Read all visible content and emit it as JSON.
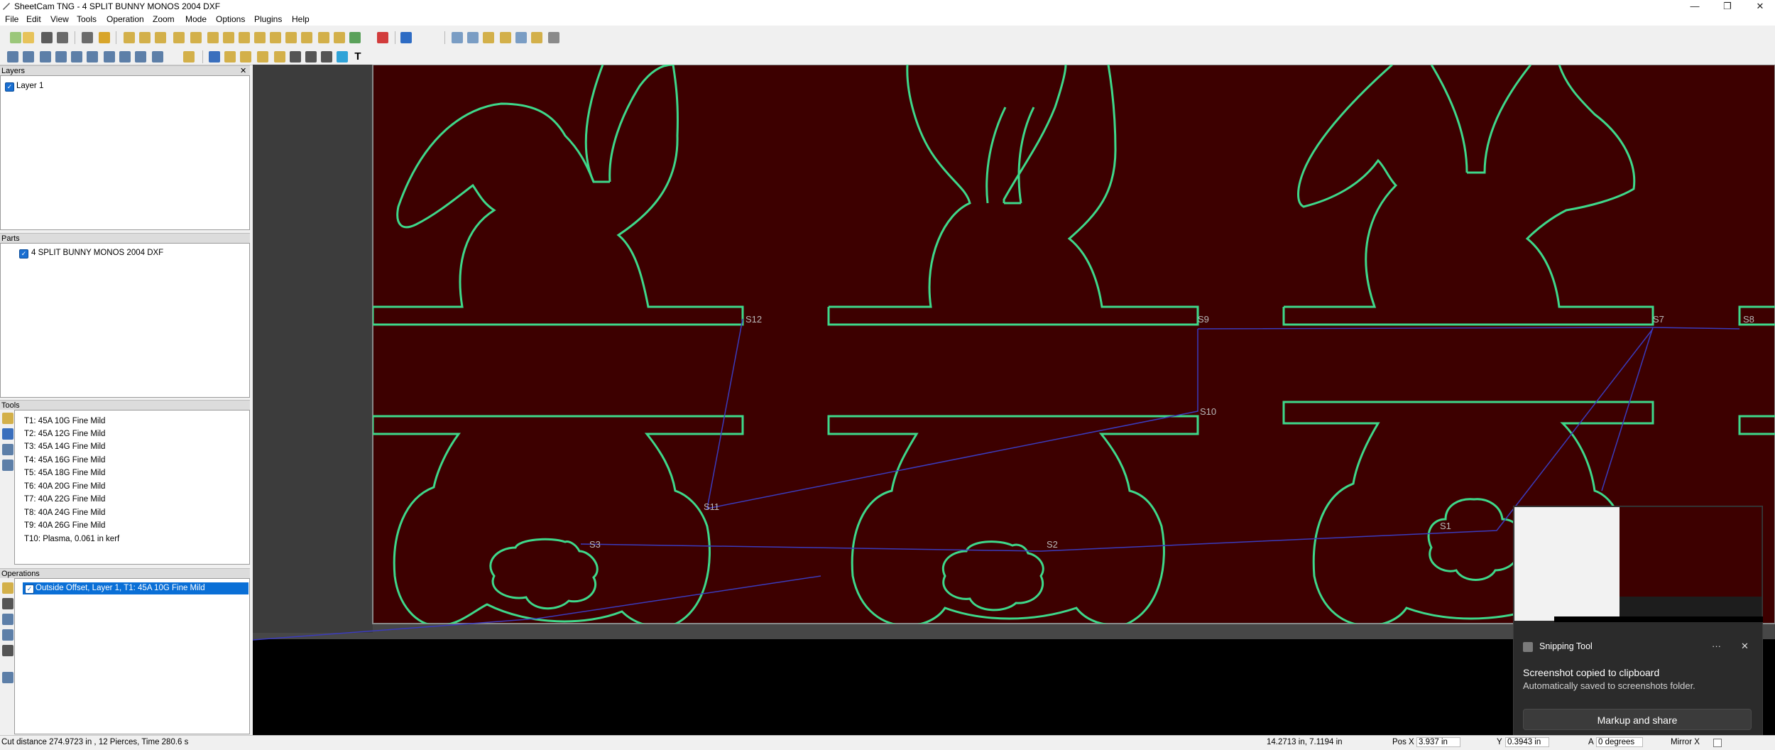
{
  "window": {
    "title": "SheetCam TNG - 4 SPLIT BUNNY MONOS 2004 DXF",
    "minimize": "—",
    "maximize": "❐",
    "close": "✕"
  },
  "menu": [
    "File",
    "Edit",
    "View",
    "Tools",
    "Operation",
    "Zoom",
    "Mode",
    "Options",
    "Plugins",
    "Help"
  ],
  "panels": {
    "layers": {
      "title": "Layers",
      "close": "✕",
      "items": [
        "Layer 1"
      ]
    },
    "parts": {
      "title": "Parts",
      "items": [
        "4 SPLIT BUNNY MONOS 2004 DXF"
      ]
    },
    "tools": {
      "title": "Tools",
      "items": [
        "T1: 45A 10G Fine Mild",
        "T2: 45A 12G Fine Mild",
        "T3: 45A 14G Fine Mild",
        "T4: 45A 16G Fine Mild",
        "T5: 45A 18G Fine Mild",
        "T6: 40A 20G Fine Mild",
        "T7: 40A 22G Fine Mild",
        "T8: 40A 24G Fine Mild",
        "T9: 40A 26G Fine Mild",
        "T10: Plasma, 0.061 in kerf"
      ]
    },
    "operations": {
      "title": "Operations",
      "items": [
        "Outside Offset, Layer 1, T1: 45A 10G Fine Mild"
      ]
    }
  },
  "canvas": {
    "labels": [
      "S12",
      "S9",
      "S7",
      "S8",
      "S10",
      "S11",
      "S3",
      "S2",
      "S1"
    ]
  },
  "status": {
    "cut_info": "Cut distance 274.9723 in , 12 Pierces, Time 280.6 s",
    "cursor": "14.2713 in, 7.1194 in",
    "pos_x_label": "Pos X",
    "pos_x": "3.937 in",
    "y_label": "Y",
    "y": "0.3943 in",
    "angle_label": "A",
    "angle": "0 degrees",
    "mirror": "Mirror X"
  },
  "toast": {
    "app": "Snipping Tool",
    "more": "···",
    "close": "✕",
    "heading": "Screenshot copied to clipboard",
    "body": "Automatically saved to screenshots folder.",
    "button": "Markup and share"
  },
  "colors": {
    "canvas_sheet": "#3d0000",
    "outline": "#3ed88a",
    "rapid": "#3b3bbd",
    "selection": "#0a6fd6"
  }
}
